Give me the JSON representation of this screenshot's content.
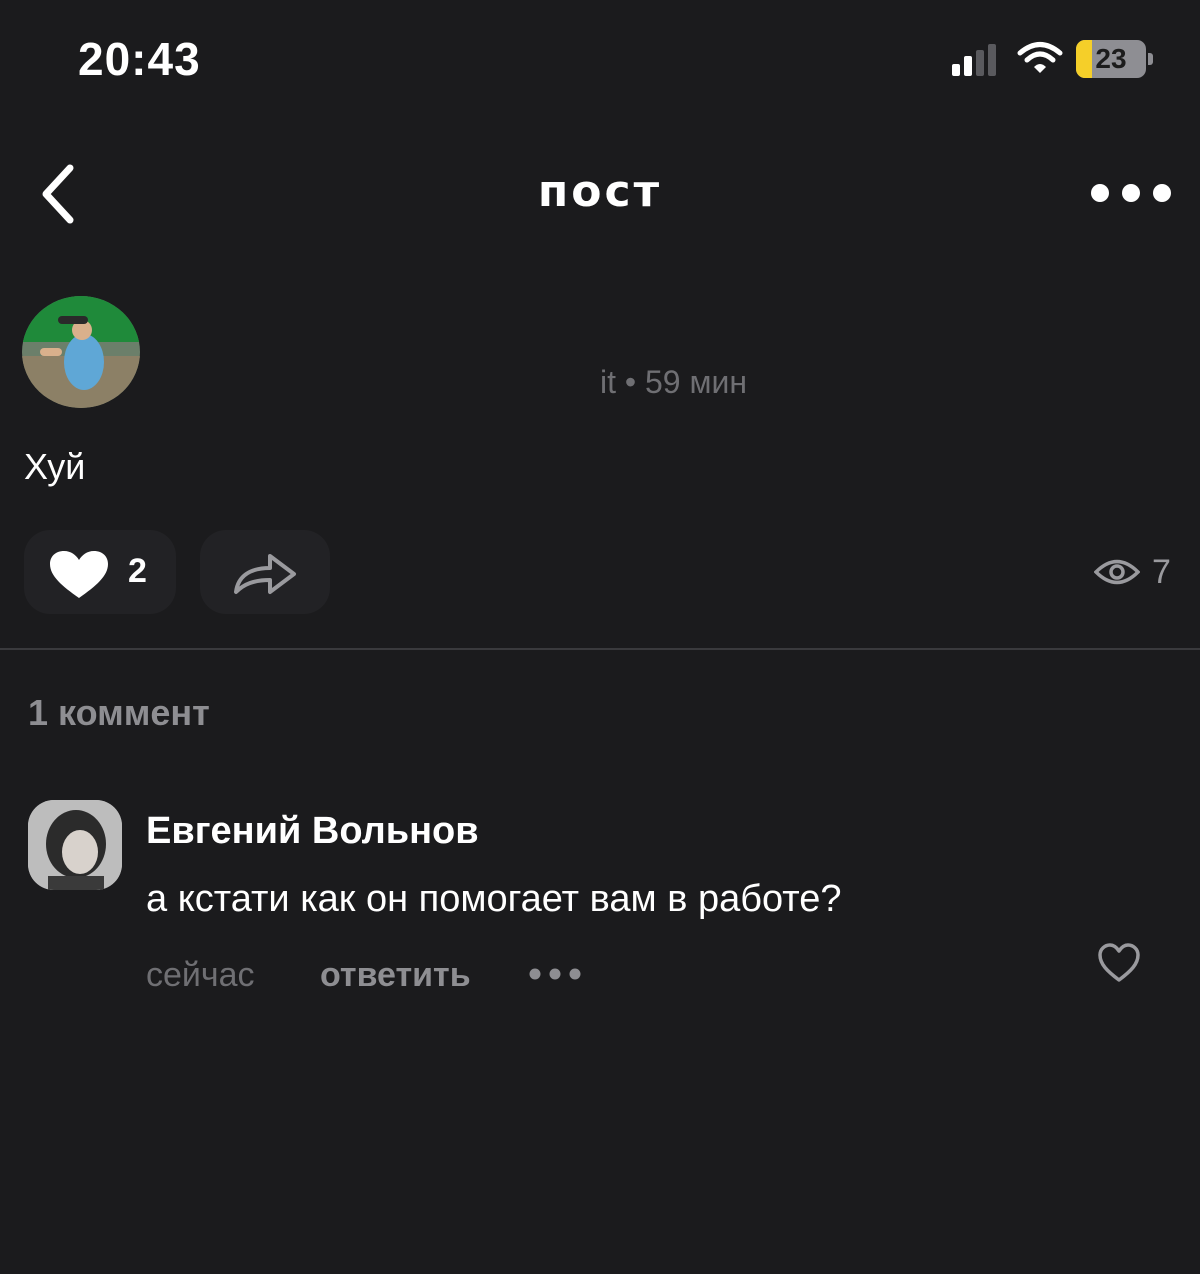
{
  "status_bar": {
    "time": "20:43",
    "battery_level": "23",
    "battery_fraction": 0.23,
    "battery_color": "#f5cf29",
    "icons": [
      "cellular-signal-icon",
      "wifi-icon",
      "battery-icon"
    ]
  },
  "header": {
    "title": "пост",
    "back_icon": "chevron-left-icon",
    "more_icon": "more-horizontal-icon"
  },
  "post": {
    "meta": "it • 59 мин",
    "text": "Хуй",
    "likes": "2",
    "views": "7",
    "icons": [
      "heart-filled-icon",
      "share-arrow-icon",
      "eye-icon"
    ]
  },
  "comments": {
    "count_label": "1 коммент",
    "items": [
      {
        "author": "Евгений Вольнов",
        "text": "а кстати как он помогает вам в работе?",
        "time": "сейчас",
        "reply_label": "ответить"
      }
    ]
  },
  "colors": {
    "background": "#1b1b1d",
    "button_bg": "#222225",
    "muted_text": "#6f6f73",
    "secondary_text": "#8e8e92"
  }
}
